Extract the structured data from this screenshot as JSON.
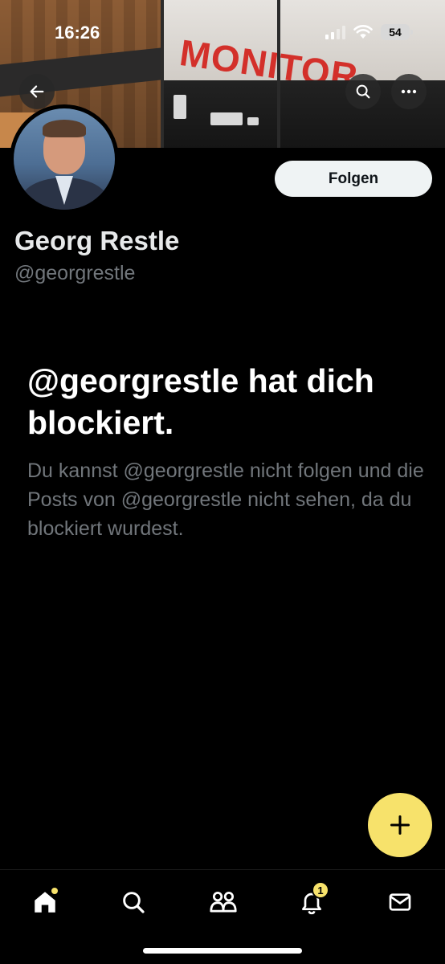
{
  "status_bar": {
    "time": "16:26",
    "battery": "54"
  },
  "banner": {
    "sign_text": "MONITOR"
  },
  "top_bar": {
    "back_icon": "arrow-left-icon",
    "search_icon": "search-icon",
    "more_icon": "more-horizontal-icon"
  },
  "profile": {
    "display_name": "Georg Restle",
    "handle": "@georgrestle",
    "follow_label": "Folgen"
  },
  "blocked": {
    "title": "@georgrestle hat dich blockiert.",
    "description": "Du kannst @georgrestle nicht folgen und die Posts von @georgrestle nicht sehen, da du blockiert wurdest."
  },
  "fab": {
    "icon": "plus-icon"
  },
  "bottom_nav": {
    "items": [
      {
        "name": "home",
        "icon": "home-icon"
      },
      {
        "name": "search",
        "icon": "search-icon"
      },
      {
        "name": "communities",
        "icon": "people-icon"
      },
      {
        "name": "notifications",
        "icon": "bell-icon",
        "badge": "1"
      },
      {
        "name": "messages",
        "icon": "mail-icon"
      }
    ]
  },
  "colors": {
    "accent": "#f7e26b",
    "background": "#000000",
    "secondary_text": "#71767b",
    "follow_button_bg": "#eff3f4"
  }
}
